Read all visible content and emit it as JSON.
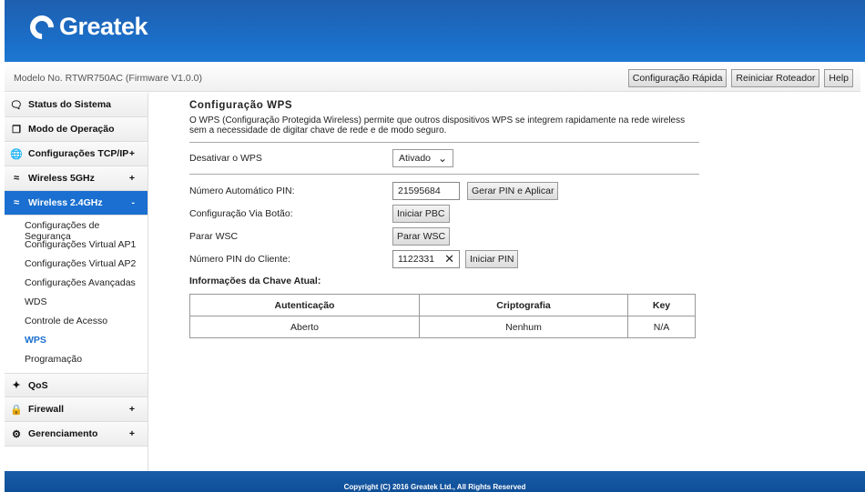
{
  "brand": {
    "name": "Greatek"
  },
  "model": "Modelo No. RTWR750AC (Firmware V1.0.0)",
  "top_buttons": [
    "Configuração Rápida",
    "Reiniciar Roteador",
    "Help"
  ],
  "sidebar": {
    "items": [
      {
        "label": "Status do Sistema",
        "icon": "chat-icon",
        "expand": ""
      },
      {
        "label": "Modo de Operação",
        "icon": "windows-icon",
        "expand": ""
      },
      {
        "label": "Configurações TCP/IP",
        "icon": "globe-icon",
        "expand": "+"
      },
      {
        "label": "Wireless 5GHz",
        "icon": "wifi-icon",
        "expand": "+"
      },
      {
        "label": "Wireless 2.4GHz",
        "icon": "wifi-icon",
        "expand": "-"
      },
      {
        "label": "QoS",
        "icon": "arrows-icon",
        "expand": ""
      },
      {
        "label": "Firewall",
        "icon": "lock-icon",
        "expand": "+"
      },
      {
        "label": "Gerenciamento",
        "icon": "gear-icon",
        "expand": "+"
      }
    ],
    "subitems": [
      "Configurações de Segurança",
      "Configurações Virtual AP1",
      "Configurações Virtual AP2",
      "Configurações Avançadas",
      "WDS",
      "Controle de Acesso",
      "WPS",
      "Programação"
    ],
    "active_sub": "WPS"
  },
  "main": {
    "title": "Configuração WPS",
    "description": "O WPS (Configuração Protegida Wireless) permite que outros dispositivos WPS se integrem rapidamente na rede wireless sem a necessidade de digitar chave de rede e de modo seguro.",
    "disable_label": "Desativar o WPS",
    "disable_value": "Ativado",
    "pin_label": "Número Automático PIN:",
    "pin_value": "21595684",
    "gen_pin_button": "Gerar PIN e Aplicar",
    "pbc_label": "Configuração Via Botão:",
    "pbc_button": "Iniciar PBC",
    "stop_label": "Parar WSC",
    "stop_button": "Parar WSC",
    "client_pin_label": "Número PIN do Cliente:",
    "client_pin_value": "1122331",
    "start_pin_button": "Iniciar PIN",
    "key_info_title": "Informações da Chave Atual:",
    "table": {
      "headers": [
        "Autenticação",
        "Criptografia",
        "Key"
      ],
      "rows": [
        [
          "Aberto",
          "Nenhum",
          "N/A"
        ]
      ]
    }
  },
  "footer": "Copyright (C) 2016 Greatek Ltd., All Rights Reserved",
  "colors": {
    "accent": "#1a6fd0",
    "header": "#1a6fc9"
  }
}
